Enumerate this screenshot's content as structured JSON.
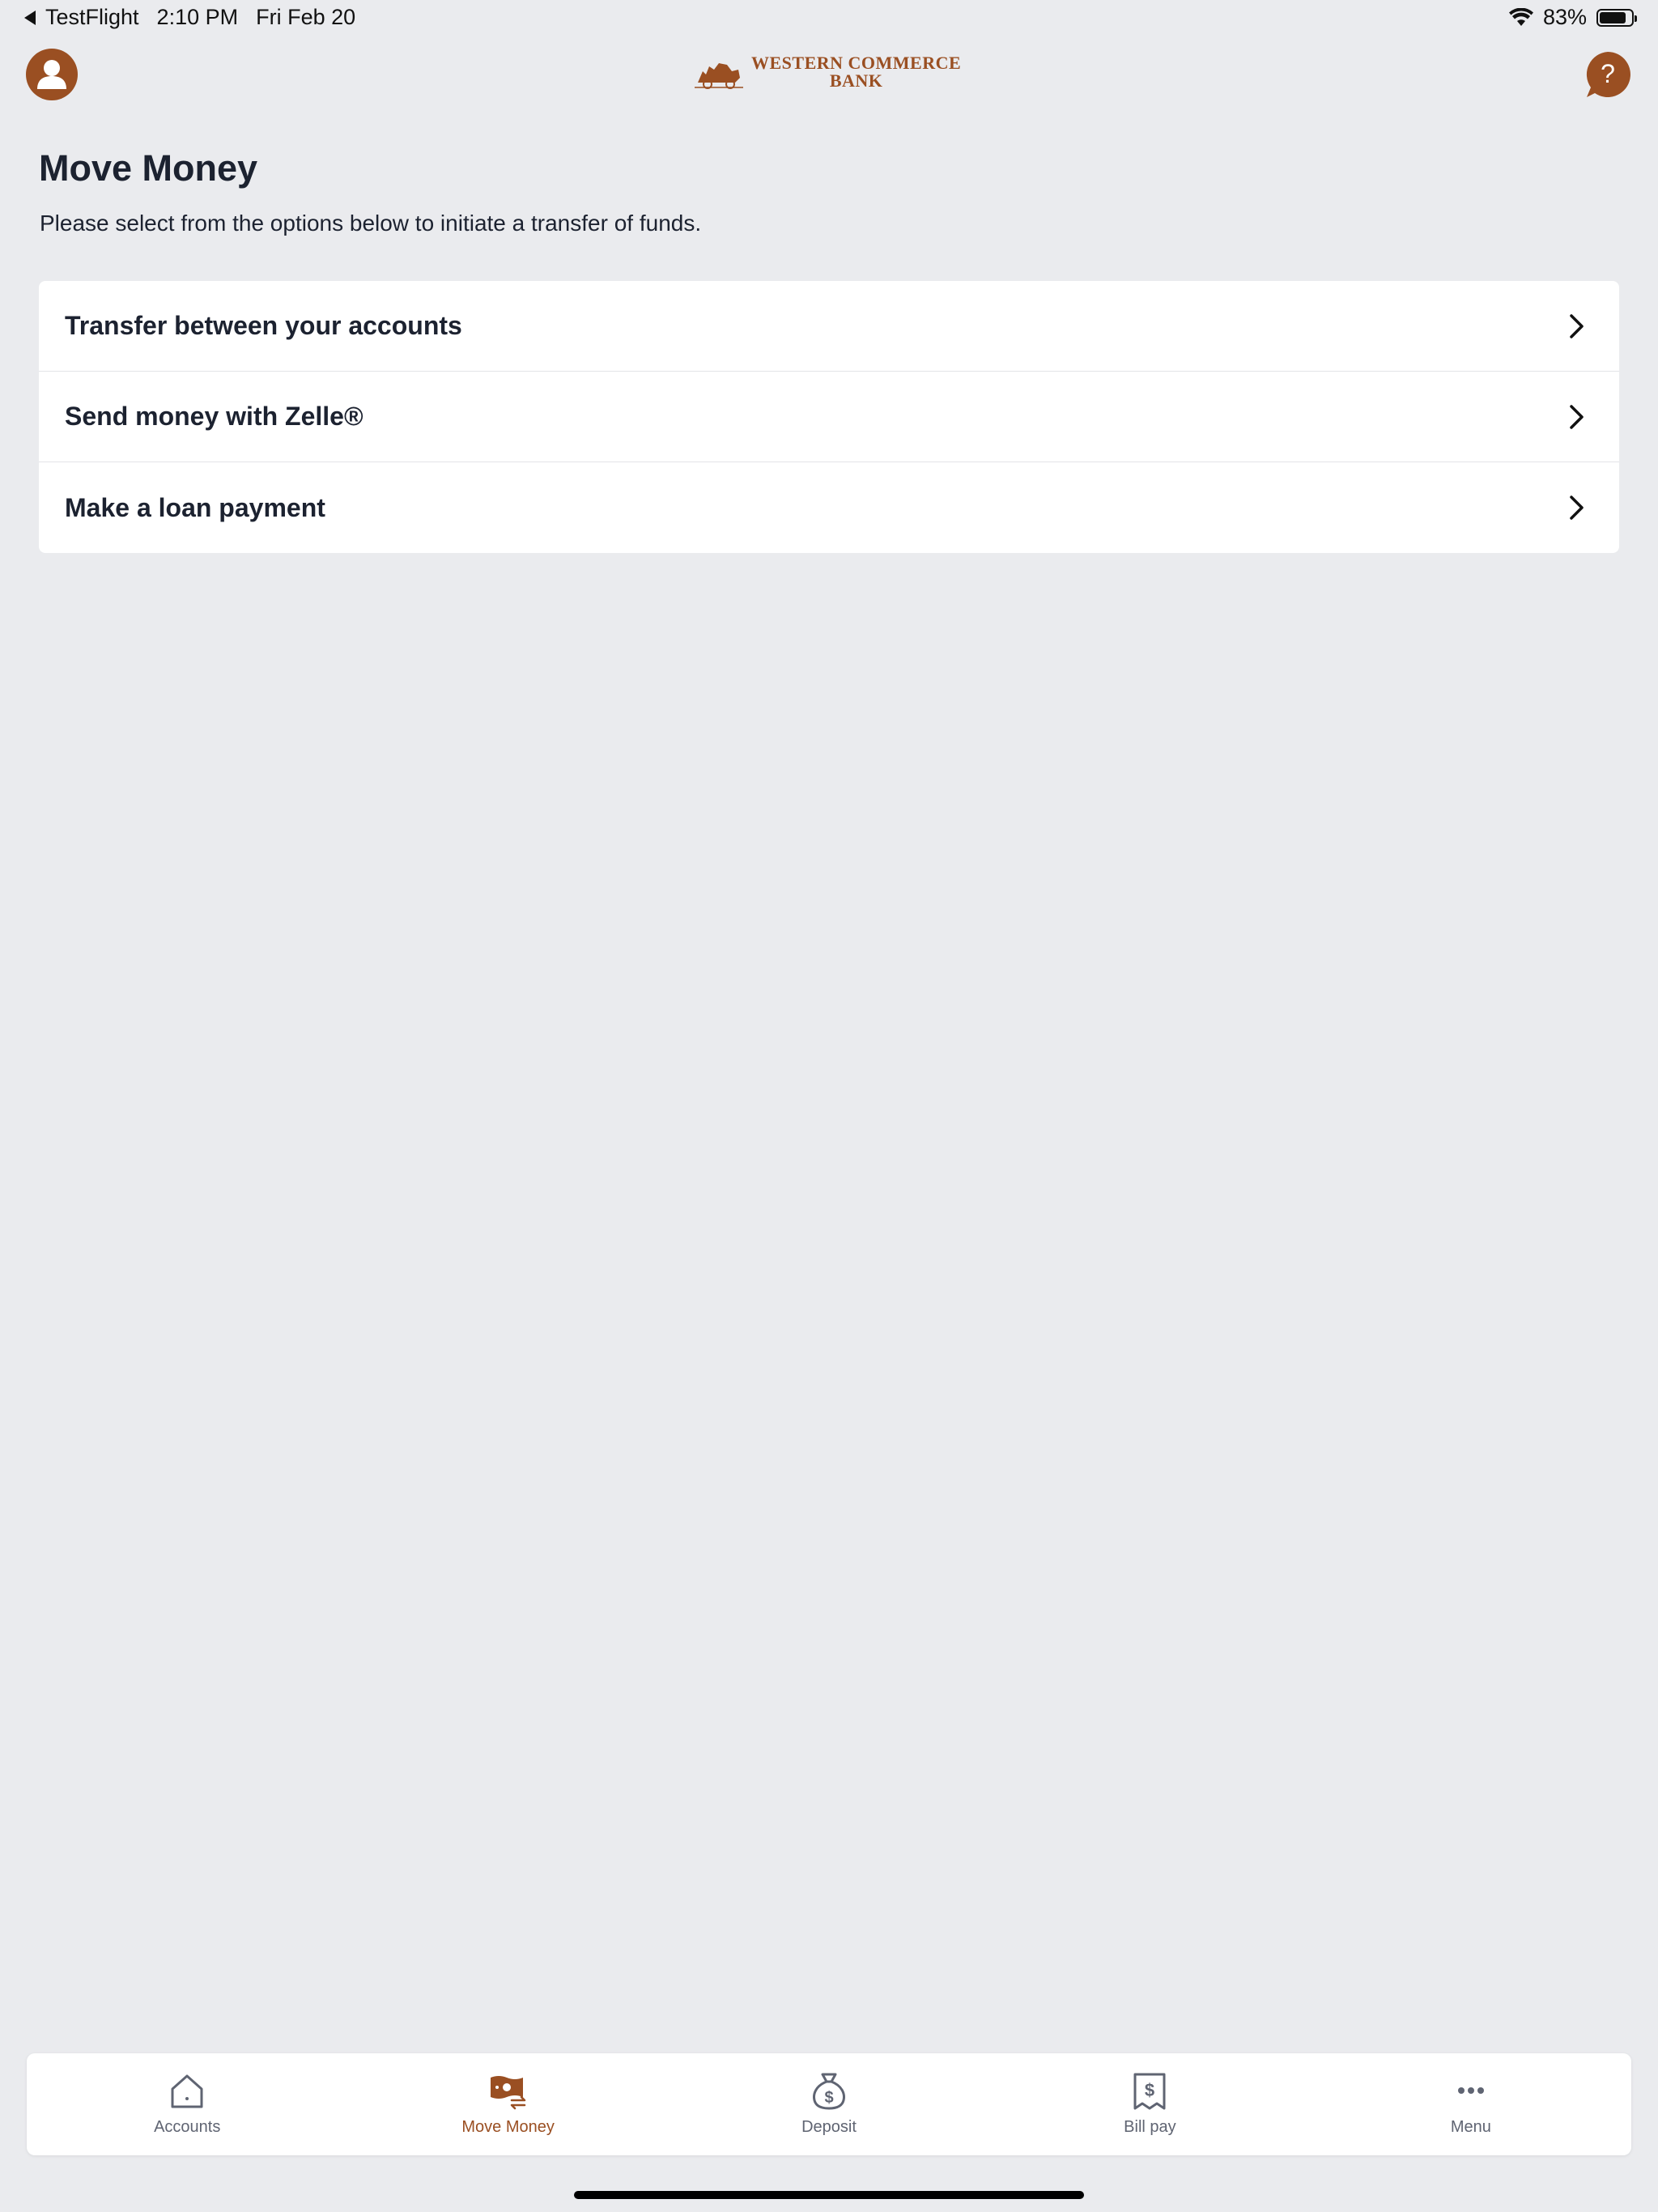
{
  "status_bar": {
    "back_app": "TestFlight",
    "time": "2:10 PM",
    "date": "Fri Feb 20",
    "battery_percent": "83%",
    "battery_level": 0.83
  },
  "header": {
    "logo_line1": "WESTERN COMMERCE",
    "logo_line2": "BANK",
    "brand_color": "#9a4f22",
    "avatar_icon": "user-avatar-icon",
    "help_icon": "help-question-icon"
  },
  "main": {
    "title": "Move Money",
    "subtitle": "Please select from the options below to initiate a transfer of funds.",
    "options": [
      {
        "label": "Transfer between your accounts"
      },
      {
        "label": "Send money with Zelle®"
      },
      {
        "label": "Make a loan payment"
      }
    ]
  },
  "bottom_nav": {
    "items": [
      {
        "label": "Accounts",
        "icon": "house-icon"
      },
      {
        "label": "Move Money",
        "icon": "money-transfer-icon",
        "active": true
      },
      {
        "label": "Deposit",
        "icon": "money-bag-icon"
      },
      {
        "label": "Bill pay",
        "icon": "bill-receipt-icon"
      },
      {
        "label": "Menu",
        "icon": "more-dots-icon"
      }
    ],
    "active_color": "#9a4f22",
    "inactive_color": "#5f6472"
  }
}
